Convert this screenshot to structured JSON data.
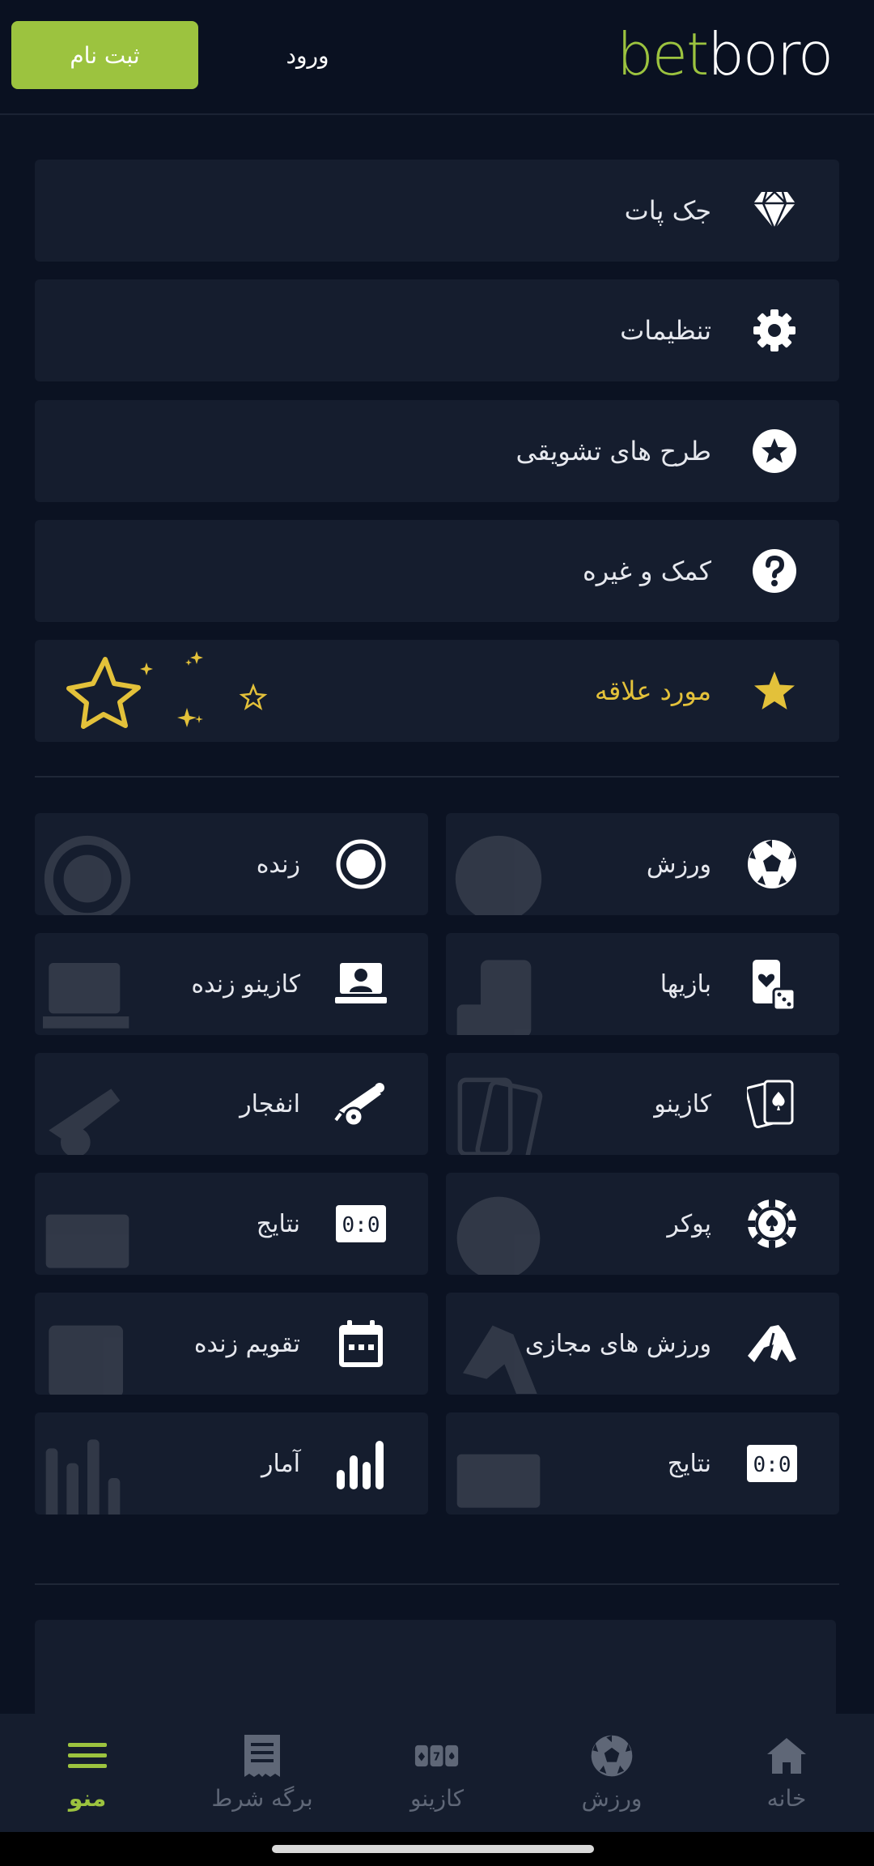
{
  "header": {
    "logo_part1": "bet",
    "logo_part2": "boro",
    "login_label": "ورود",
    "register_label": "ثبت نام"
  },
  "menu": [
    {
      "label": "جک پات",
      "icon": "diamond-icon"
    },
    {
      "label": "تنظیمات",
      "icon": "gear-icon"
    },
    {
      "label": "طرح های تشویقی",
      "icon": "star-circle-icon"
    },
    {
      "label": "کمک و غیره",
      "icon": "question-icon"
    },
    {
      "label": "مورد علاقه",
      "icon": "star-icon"
    }
  ],
  "grid": {
    "right": [
      {
        "label": "ورزش",
        "icon": "soccer-ball-icon"
      },
      {
        "label": "بازیها",
        "icon": "card-dice-icon"
      },
      {
        "label": "کازینو",
        "icon": "playing-cards-icon"
      },
      {
        "label": "پوکر",
        "icon": "poker-chip-icon"
      },
      {
        "label": "ورزش های مجازی",
        "icon": "horse-icon"
      },
      {
        "label": "نتایج",
        "icon": "scoreboard-icon"
      }
    ],
    "left": [
      {
        "label": "زنده",
        "icon": "live-record-icon"
      },
      {
        "label": "کازینو زنده",
        "icon": "live-dealer-icon"
      },
      {
        "label": "انفجار",
        "icon": "cannon-icon"
      },
      {
        "label": "نتایج",
        "icon": "scoreboard-icon"
      },
      {
        "label": "تقویم زنده",
        "icon": "calendar-icon"
      },
      {
        "label": "آمار",
        "icon": "stats-bars-icon"
      }
    ]
  },
  "bottom_nav": [
    {
      "label": "خانه",
      "icon": "home-icon"
    },
    {
      "label": "ورزش",
      "icon": "soccer-ball-icon"
    },
    {
      "label": "کازینو",
      "icon": "slot-machine-icon"
    },
    {
      "label": "برگه شرط",
      "icon": "receipt-icon"
    },
    {
      "label": "منو",
      "icon": "hamburger-icon",
      "active": true
    }
  ],
  "colors": {
    "accent": "#9cc33f",
    "favorite": "#e3c13a",
    "background": "#0b1222",
    "card": "#151d2e"
  }
}
